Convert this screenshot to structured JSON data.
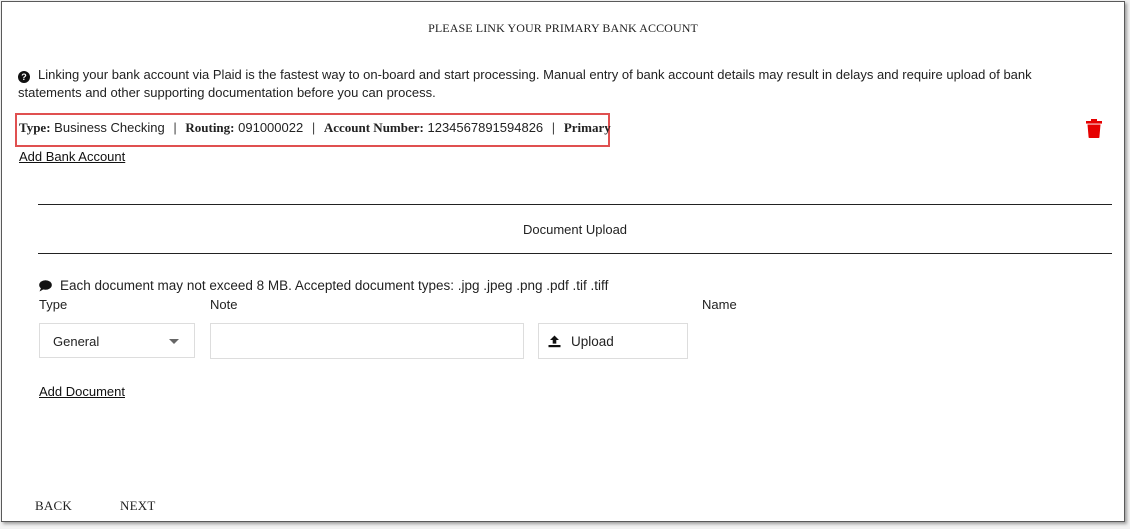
{
  "page": {
    "title": "PLEASE LINK YOUR PRIMARY BANK ACCOUNT",
    "info_text": "Linking your bank account via Plaid is the fastest way to on-board and start processing. Manual entry of bank account details may result in delays and require upload of bank statements and other supporting documentation before you can process."
  },
  "account": {
    "type_label": "Type:",
    "type_value": "Business Checking",
    "routing_label": "Routing:",
    "routing_value": "091000022",
    "number_label": "Account Number:",
    "number_value": "1234567891594826",
    "primary": "Primary",
    "separator": "|",
    "add_link": "Add Bank Account"
  },
  "documents": {
    "section_title": "Document Upload",
    "note": "Each document may not exceed 8 MB. Accepted document types: .jpg .jpeg .png .pdf .tif .tiff",
    "type_label": "Type",
    "note_label": "Note",
    "name_label": "Name",
    "type_selected": "General",
    "note_value": "",
    "upload_label": "Upload",
    "add_link": "Add Document"
  },
  "nav": {
    "back": "BACK",
    "next": "NEXT"
  },
  "colors": {
    "highlight_border": "#e05050",
    "delete_icon": "#e60000"
  },
  "icons": {
    "info": "question-circle-icon",
    "delete": "trash-icon",
    "note": "speech-bubble-icon",
    "upload": "upload-icon",
    "dropdown": "caret-down-icon"
  }
}
